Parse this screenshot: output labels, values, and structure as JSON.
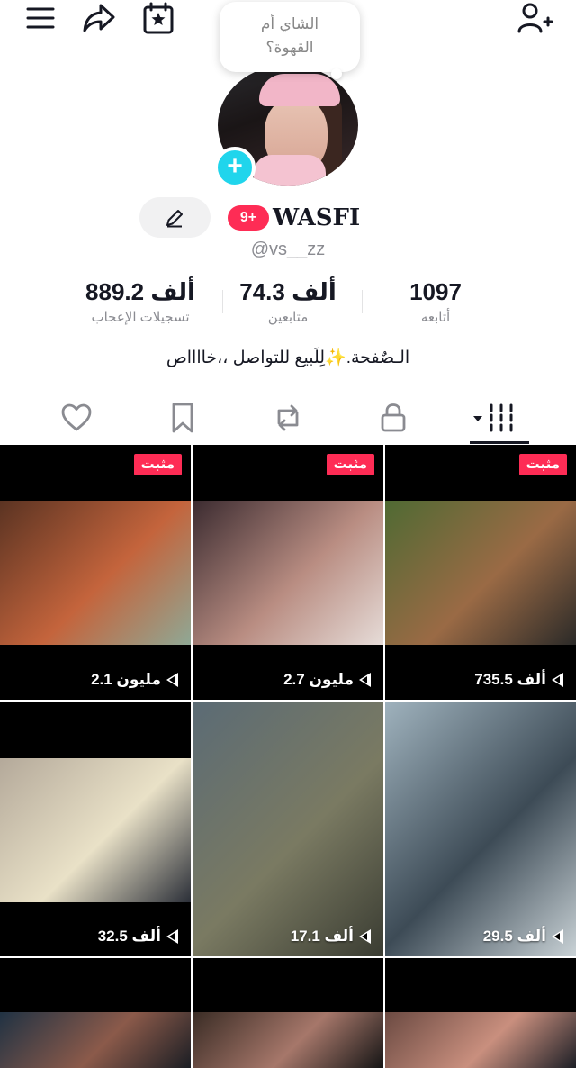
{
  "bubble": {
    "line1": "الشاي أم",
    "line2": "القهوة؟"
  },
  "profile": {
    "username": "WASFI",
    "handle": "@vs__zz",
    "notification_badge": "9+",
    "bio": "الـصٌفحة.✨لِلَبيع للتواصل ،،خااااص"
  },
  "stats": [
    {
      "value": "889.2 ألف",
      "label": "تسجيلات الإعجاب"
    },
    {
      "value": "74.3 ألف",
      "label": "متابعين"
    },
    {
      "value": "1097",
      "label": "أتابعه"
    }
  ],
  "icons": {
    "menu": "menu-icon",
    "share": "share-icon",
    "calendar": "calendar-star-icon",
    "add_friend": "add-person-icon",
    "edit": "pencil-icon",
    "tabs": [
      "liked-heart-icon",
      "bookmark-icon",
      "repost-icon",
      "lock-icon",
      "videos-grid-icon"
    ]
  },
  "colors": {
    "accent": "#fe2c55",
    "avatar_add": "#20d5ec",
    "text": "#161823",
    "muted": "#8a8b91"
  },
  "videos": [
    {
      "pinned": "مثبت",
      "views": "2.1 مليون",
      "theme": [
        "#5a3322",
        "#c4643c",
        "#8fa895"
      ]
    },
    {
      "pinned": "مثبت",
      "views": "2.7 مليون",
      "theme": [
        "#3b2b30",
        "#b98d82",
        "#e6dcd8"
      ]
    },
    {
      "pinned": "مثبت",
      "views": "735.5 ألف",
      "theme": [
        "#4f6a33",
        "#9a6a45",
        "#2b2a28"
      ]
    },
    {
      "pinned": "",
      "views": "32.5 ألف",
      "theme": [
        "#b4a99a",
        "#e9e1c7",
        "#2b2f38"
      ]
    },
    {
      "pinned": "",
      "views": "17.1 ألف",
      "theme": [
        "#5b6b75",
        "#7a7a62",
        "#3a3c32"
      ]
    },
    {
      "pinned": "",
      "views": "29.5 ألف",
      "theme": [
        "#9fb2bd",
        "#3d4b56",
        "#c9d2d6"
      ]
    },
    {
      "pinned": "",
      "views": "",
      "theme": [
        "#203243",
        "#8b5a4a",
        "#1b1e24"
      ]
    },
    {
      "pinned": "",
      "views": "",
      "theme": [
        "#3a2c25",
        "#a6776a",
        "#151515"
      ]
    },
    {
      "pinned": "",
      "views": "",
      "theme": [
        "#6b4a42",
        "#c98f7e",
        "#1d1f26"
      ]
    }
  ]
}
